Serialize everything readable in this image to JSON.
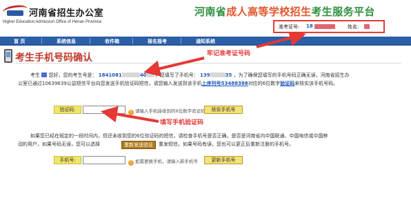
{
  "header": {
    "org_name_cn": "河南省招生办公室",
    "org_name_en": "Higher Education Admission Office of Henan Province",
    "platform_part1": "河南省",
    "platform_part2": "成人高等学校招生",
    "platform_part3": "考生服务平台"
  },
  "userbox": {
    "ticket_label": "准考证号:",
    "ticket_value": "18",
    "name_label": "姓名:"
  },
  "nav": {
    "items": [
      "首  页",
      "系统信息",
      "收件箱",
      "报名报考",
      "通知系统"
    ]
  },
  "page": {
    "title": "考生手机号码确认"
  },
  "paragraph1": {
    "line1_a": "考生",
    "line1_b": "您好，您的考生号是：",
    "exam_no": "1841081",
    "exam_no_tail": "40",
    "line1_c": "，您填写了手机号：",
    "phone_a": "139",
    "phone_b": "35",
    "line1_d": "，为了确保您填写的手机号码正确无误，河南省招生办",
    "line2_a": "公室已通过10639639公益短信平台向您发送手机验证码短信，请您输入发送到该手机",
    "line2_b": "上序列号53488388",
    "line2_c": "对应的6位数字",
    "line2_d": "验证码",
    "line2_e": "来核实该手机号码。"
  },
  "verify_row": {
    "label": "验证码:",
    "hint": "请输入手机接收到的6位数字验证码",
    "button": "核实手机号"
  },
  "paragraph2": {
    "line1": "如果您已经在规定的一段时间内，但还未收到您的6位验证码的短信，请检查手机号是否正确，是否是河南省内中国联通、中国电信或中国移",
    "line2_a": "动的用户，如果号码无误，您可以选择",
    "resend_button": "重新发送验证",
    "line2_b": "重发短信。如果号码有误，您也可以更正后重新注册的手机号。"
  },
  "phone_row": {
    "label": "手机号:",
    "hint": "如需更换手机，请输入新手机号",
    "button": "更新手机号"
  },
  "annotations": {
    "note1": "牢记准考证号码",
    "note2": "填写手机验证码"
  },
  "colors": {
    "nav_bg": "#2b5fa8",
    "annotation_red": "#e53935",
    "title_red": "#c0392b",
    "platform_green": "#2f8f3e",
    "platform_orange": "#e0552b"
  }
}
